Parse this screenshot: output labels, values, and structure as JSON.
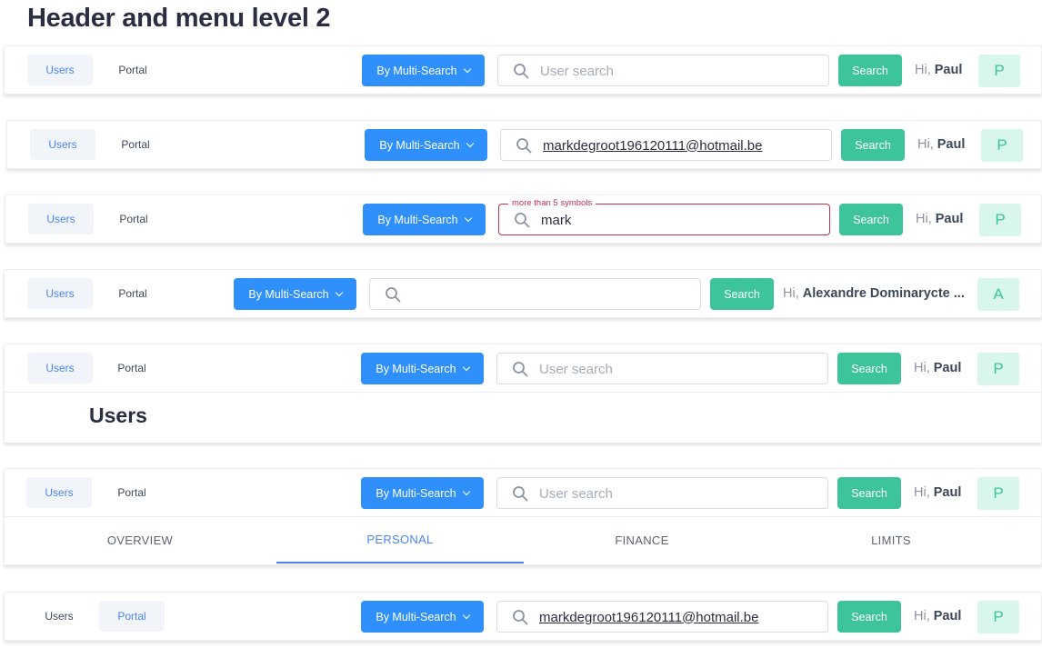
{
  "page_title": "Header and menu level 2",
  "icons": {
    "search": "search-icon",
    "dropdown": "chevron-down-icon"
  },
  "colors": {
    "primary_blue": "#2f8ffb",
    "search_green": "#3dc49a",
    "avatar_bg": "#d9f6ea",
    "error_red": "#c0314a",
    "active_tab": "#4c85f2"
  },
  "headers": [
    {
      "nav": [
        {
          "label": "Users",
          "active": true
        },
        {
          "label": "Portal",
          "active": false
        }
      ],
      "multi_search": "By Multi-Search",
      "search_value": "",
      "search_placeholder": "User search",
      "search_button": "Search",
      "greeting": "Hi,",
      "user_name": "Paul",
      "avatar": "P"
    },
    {
      "nav": [
        {
          "label": "Users",
          "active": true
        },
        {
          "label": "Portal",
          "active": false
        }
      ],
      "multi_search": "By Multi-Search",
      "search_value": "markdegroot196120111@hotmail.be",
      "search_placeholder": "",
      "search_button": "Search",
      "greeting": "Hi,",
      "user_name": "Paul",
      "avatar": "P"
    },
    {
      "nav": [
        {
          "label": "Users",
          "active": true
        },
        {
          "label": "Portal",
          "active": false
        }
      ],
      "multi_search": "By Multi-Search",
      "search_value": "mark",
      "search_placeholder": "",
      "search_error": "more than 5 symbols",
      "search_button": "Search",
      "greeting": "Hi,",
      "user_name": "Paul",
      "avatar": "P"
    },
    {
      "nav": [
        {
          "label": "Users",
          "active": true
        },
        {
          "label": "Portal",
          "active": false
        }
      ],
      "multi_search": "By Multi-Search",
      "search_value": "",
      "search_placeholder": "",
      "search_button": "Search",
      "greeting": "Hi,",
      "user_name": "Alexandre Dominarycte ...",
      "avatar": "A"
    },
    {
      "nav": [
        {
          "label": "Users",
          "active": true
        },
        {
          "label": "Portal",
          "active": false
        }
      ],
      "multi_search": "By Multi-Search",
      "search_value": "",
      "search_placeholder": "User search",
      "search_button": "Search",
      "greeting": "Hi,",
      "user_name": "Paul",
      "avatar": "P",
      "sub_heading": "Users"
    },
    {
      "nav": [
        {
          "label": "Users",
          "active": true
        },
        {
          "label": "Portal",
          "active": false
        }
      ],
      "multi_search": "By Multi-Search",
      "search_value": "",
      "search_placeholder": "User search",
      "search_button": "Search",
      "greeting": "Hi,",
      "user_name": "Paul",
      "avatar": "P",
      "tabs": [
        {
          "label": "OVERVIEW",
          "active": false
        },
        {
          "label": "PERSONAL",
          "active": true
        },
        {
          "label": "FINANCE",
          "active": false
        },
        {
          "label": "LIMITS",
          "active": false
        }
      ]
    },
    {
      "nav": [
        {
          "label": "Users",
          "active": false
        },
        {
          "label": "Portal",
          "active": true
        }
      ],
      "multi_search": "By Multi-Search",
      "search_value": "markdegroot196120111@hotmail.be",
      "search_placeholder": "",
      "search_button": "Search",
      "greeting": "Hi,",
      "user_name": "Paul",
      "avatar": "P"
    }
  ]
}
